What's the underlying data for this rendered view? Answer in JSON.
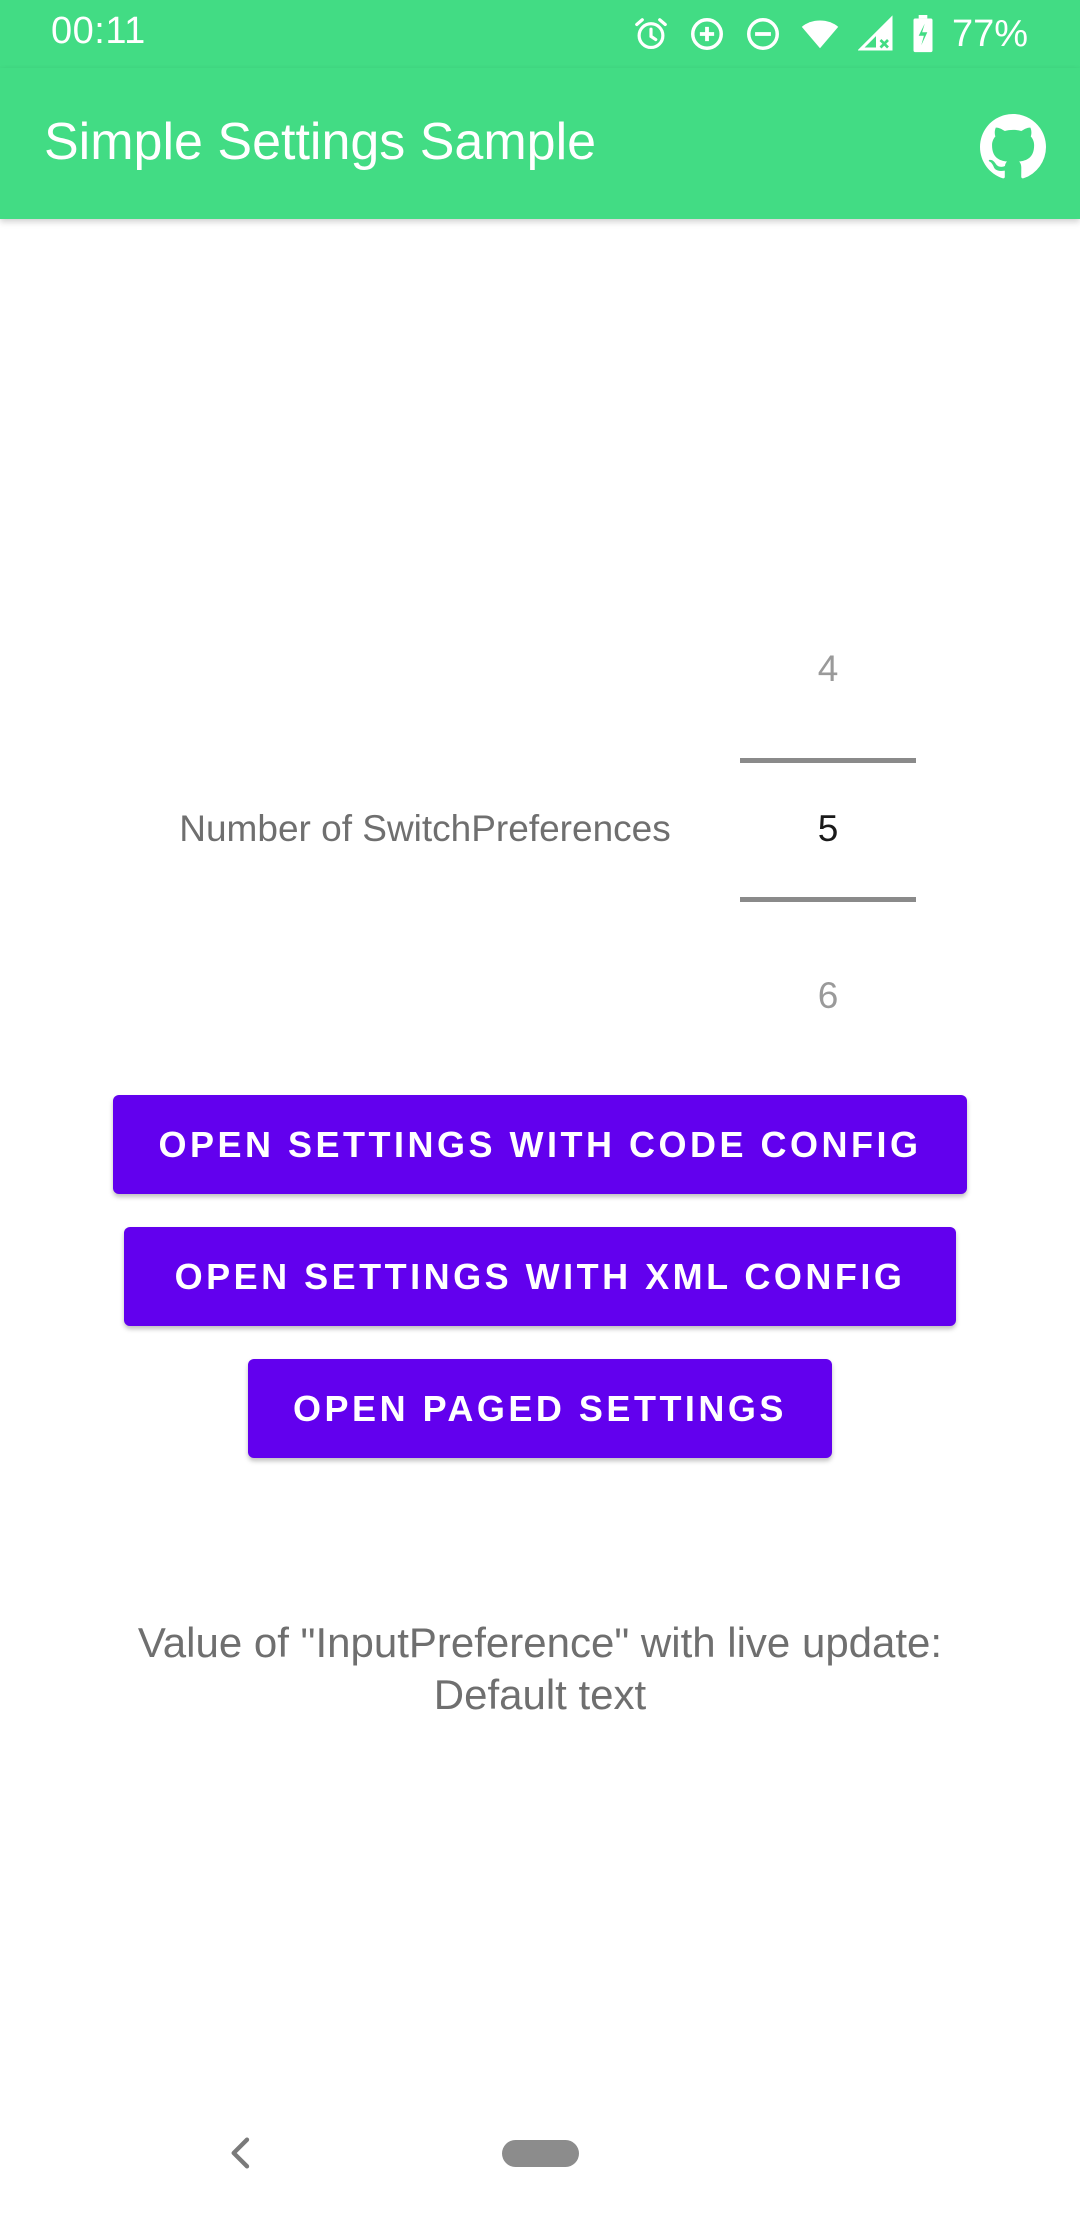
{
  "status_bar": {
    "time": "00:11",
    "battery": "77%",
    "icons": [
      "alarm-icon",
      "data-saver-icon",
      "do-not-disturb-icon",
      "wifi-icon",
      "cell-signal-icon",
      "battery-charging-icon"
    ]
  },
  "toolbar": {
    "title": "Simple Settings Sample",
    "action_icon": "github-icon",
    "background_color": "#42dc84"
  },
  "picker": {
    "label": "Number of SwitchPreferences",
    "previous": "4",
    "current": "5",
    "next": "6"
  },
  "buttons": {
    "code_config": "OPEN SETTINGS WITH CODE CONFIG",
    "xml_config": "OPEN SETTINGS WITH XML CONFIG",
    "paged": "OPEN PAGED SETTINGS",
    "color": "#6200ee"
  },
  "live_update": {
    "label": "Value of \"InputPreference\" with live update:",
    "value": "Default text"
  },
  "nav_bar": {
    "icons": [
      "back-icon",
      "home-pill-icon"
    ]
  }
}
